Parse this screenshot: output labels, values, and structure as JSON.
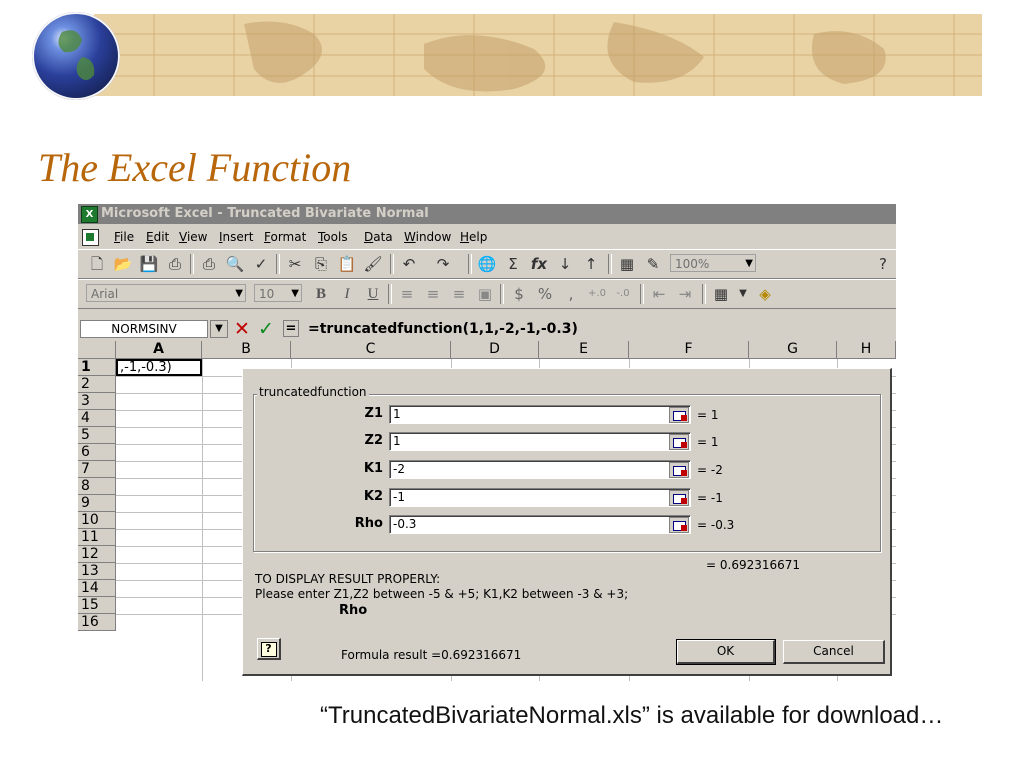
{
  "slide": {
    "title": "The Excel Function",
    "caption": "“TruncatedBivariateNormal.xls” is available for download…"
  },
  "excel": {
    "window_title": "Microsoft Excel - Truncated Bivariate Normal",
    "menus": [
      "File",
      "Edit",
      "View",
      "Insert",
      "Format",
      "Tools",
      "Data",
      "Window",
      "Help"
    ],
    "toolbar": {
      "zoom": "100%",
      "font_name": "Arial",
      "font_size": "10"
    },
    "formula_bar": {
      "name_box": "NORMSINV",
      "equals": "=",
      "formula": "=truncatedfunction(1,1,-2,-1,-0.3)"
    },
    "columns": [
      "A",
      "B",
      "C",
      "D",
      "E",
      "F",
      "G",
      "H"
    ],
    "rows": [
      "1",
      "2",
      "3",
      "4",
      "5",
      "6",
      "7",
      "8",
      "9",
      "10",
      "11",
      "12",
      "13",
      "14",
      "15",
      "16"
    ],
    "cell_a1": ",-1,-0.3)"
  },
  "dialog": {
    "function_name": "truncatedfunction",
    "args": [
      {
        "label": "Z1",
        "value": "1",
        "evaluated": "= 1"
      },
      {
        "label": "Z2",
        "value": "1",
        "evaluated": "= 1"
      },
      {
        "label": "K1",
        "value": "-2",
        "evaluated": "= -2"
      },
      {
        "label": "K2",
        "value": "-1",
        "evaluated": "= -1"
      },
      {
        "label": "Rho",
        "value": "-0.3",
        "evaluated": "= -0.3"
      }
    ],
    "overall_value": "= 0.692316671",
    "description_line1": "TO DISPLAY RESULT PROPERLY:",
    "description_line2": "Please enter Z1,Z2 between -5 & +5; K1,K2 between -3 & +3;",
    "current_arg": "Rho",
    "help_label": "?",
    "formula_result": "Formula result =0.692316671",
    "ok_label": "OK",
    "cancel_label": "Cancel"
  },
  "colors": {
    "title": "#b8660a",
    "banner": "#e9d3a4",
    "window_face": "#d4d0c8",
    "titlebar_inactive": "#808080"
  }
}
